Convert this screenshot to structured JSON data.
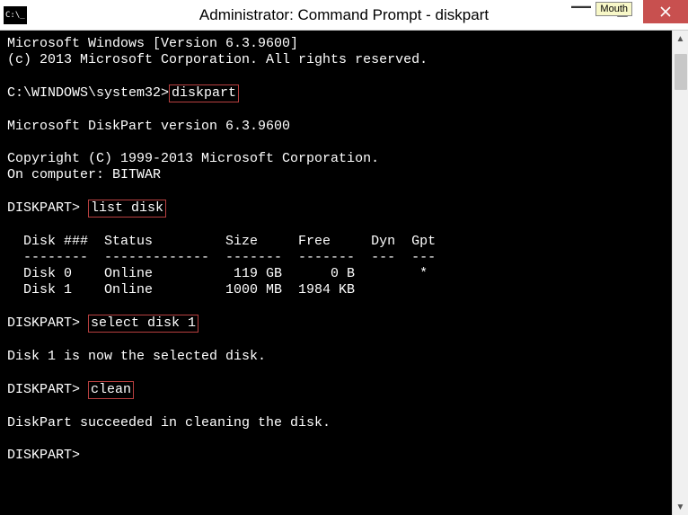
{
  "titlebar": {
    "title": "Administrator: Command Prompt - diskpart",
    "tooltip": "Mouth",
    "minimize": "—",
    "maximize": "▢",
    "close": "✕"
  },
  "sysicon": "C:\\_",
  "terminal": {
    "line01": "Microsoft Windows [Version 6.3.9600]",
    "line02": "(c) 2013 Microsoft Corporation. All rights reserved.",
    "blank": "",
    "prompt1_prefix": "C:\\WINDOWS\\system32>",
    "cmd1": "diskpart",
    "line_dp_ver": "Microsoft DiskPart version 6.3.9600",
    "line_cpr": "Copyright (C) 1999-2013 Microsoft Corporation.",
    "line_comp": "On computer: BITWAR",
    "dp_prompt": "DISKPART> ",
    "cmd2": "list disk",
    "tbl_head": "  Disk ###  Status         Size     Free     Dyn  Gpt",
    "tbl_div": "  --------  -------------  -------  -------  ---  ---",
    "tbl_row0": "  Disk 0    Online          119 GB      0 B        *",
    "tbl_row1": "  Disk 1    Online         1000 MB  1984 KB",
    "cmd3": "select disk 1",
    "line_sel": "Disk 1 is now the selected disk.",
    "cmd4": "clean",
    "line_clean": "DiskPart succeeded in cleaning the disk.",
    "final_prompt": "DISKPART>"
  },
  "scroll": {
    "up": "▲",
    "down": "▼"
  }
}
